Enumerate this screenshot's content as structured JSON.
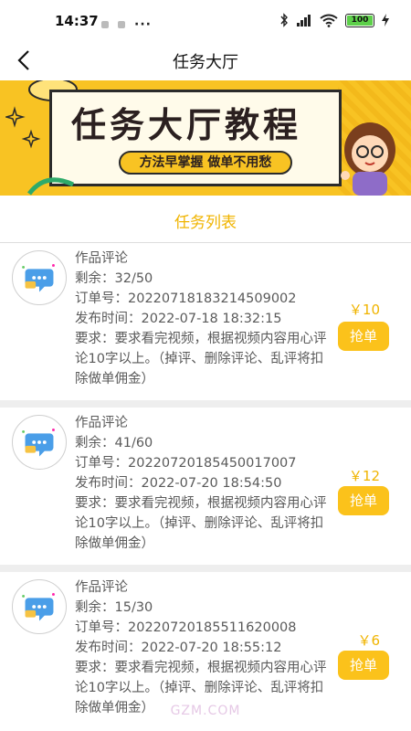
{
  "status_bar": {
    "time": "14:37",
    "more": "···",
    "battery": "100"
  },
  "nav": {
    "title": "任务大厅"
  },
  "banner": {
    "title": "任务大厅教程",
    "subtitle": "方法早掌握 做单不用愁"
  },
  "section": {
    "title": "任务列表"
  },
  "tasks": [
    {
      "type": "作品评论",
      "remaining": "剩余：32/50",
      "order": "订单号：20220718183214509002",
      "published": "发布时间：2022-07-18 18:32:15",
      "requirement": "要求：要求看完视频，根据视频内容用心评论10字以上。（掉评、删除评论、乱评将扣除做单佣金）",
      "price": "￥10",
      "button": "抢单"
    },
    {
      "type": "作品评论",
      "remaining": "剩余：41/60",
      "order": "订单号：20220720185450017007",
      "published": "发布时间：2022-07-20 18:54:50",
      "requirement": "要求：要求看完视频，根据视频内容用心评论10字以上。（掉评、删除评论、乱评将扣除做单佣金）",
      "price": "￥12",
      "button": "抢单"
    },
    {
      "type": "作品评论",
      "remaining": "剩余：15/30",
      "order": "订单号：20220720185511620008",
      "published": "发布时间：2022-07-20 18:55:12",
      "requirement": "要求：要求看完视频，根据视频内容用心评论10字以上。（掉评、删除评论、乱评将扣除做单佣金）",
      "price": "￥6",
      "button": "抢单"
    }
  ],
  "watermark": "GZM.COM",
  "colors": {
    "accent": "#f0b400",
    "button": "#fbc21b",
    "banner": "#f8c323"
  }
}
